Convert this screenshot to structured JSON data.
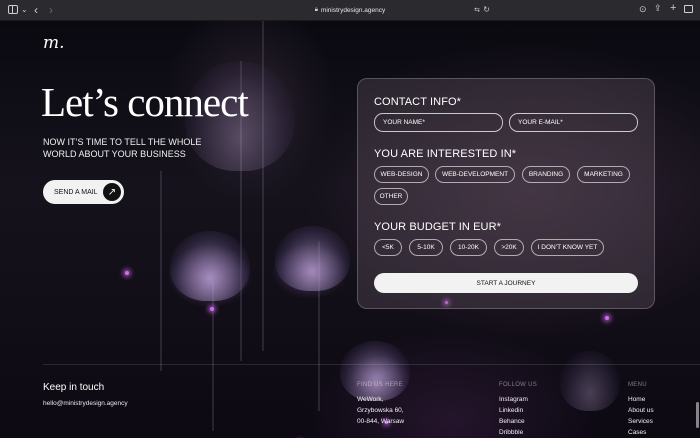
{
  "browser": {
    "url": "ministrydesign.agency"
  },
  "logo": {
    "text": "m."
  },
  "hero": {
    "title": "Let’s connect",
    "subtitle": "NOW IT’S TIME TO TELL THE WHOLE WORLD ABOUT YOUR BUSINESS",
    "send_button": "SEND A MAIL"
  },
  "form": {
    "contact_title": "CONTACT INFO*",
    "name_placeholder": "YOUR NAME*",
    "email_placeholder": "YOUR E-MAIL*",
    "interest_title": "YOU ARE INTERESTED IN*",
    "interests": [
      "WEB-DESIGN",
      "WEB-DEVELOPMENT",
      "BRANDING",
      "MARKETING",
      "OTHER"
    ],
    "budget_title": "YOUR BUDGET IN EUR*",
    "budgets": [
      "<5K",
      "5-10K",
      "10-20K",
      ">20K",
      "I DON’T KNOW YET"
    ],
    "submit": "START A JOURNEY"
  },
  "footer": {
    "keep_title": "Keep in touch",
    "email": "hello@ministrydesign.agency",
    "find_us": {
      "heading": "FIND US HERE",
      "lines": [
        "WeWork,",
        "Grzybowska 60,",
        "00-844, Warsaw"
      ]
    },
    "follow_us": {
      "heading": "FOLLOW US",
      "links": [
        "Instagram",
        "Linkedin",
        "Behance",
        "Dribbble"
      ]
    },
    "menu": {
      "heading": "MENU",
      "links": [
        "Home",
        "About us",
        "Services",
        "Cases"
      ]
    }
  },
  "colors": {
    "background": "#0d0b14",
    "button_light": "#f2f2f2",
    "accent_glow": "#d06cf0"
  }
}
